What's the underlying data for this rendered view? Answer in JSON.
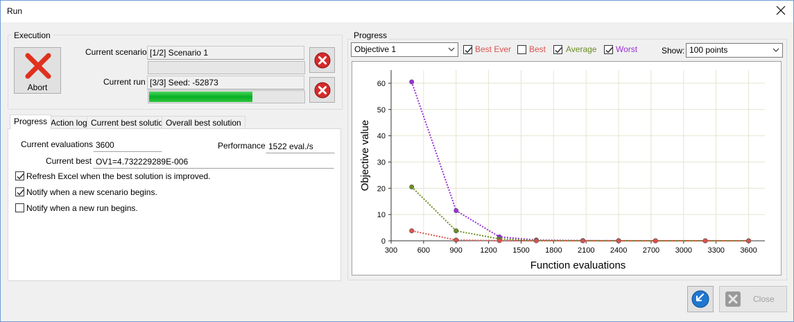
{
  "window": {
    "title": "Run"
  },
  "execution": {
    "group_label": "Execution",
    "abort_label": "Abort",
    "current_scenario_label": "Current scenario",
    "current_scenario_value": "[1/2] Scenario 1",
    "scenario_progress": 0.0,
    "current_run_label": "Current run",
    "current_run_value": "[3/3] Seed: -52873",
    "run_progress": 0.67
  },
  "tabs": [
    {
      "label": "Progress",
      "active": true
    },
    {
      "label": "Action log",
      "active": false
    },
    {
      "label": "Current best solution",
      "active": false
    },
    {
      "label": "Overall best solution",
      "active": false
    }
  ],
  "progress_tab": {
    "current_evaluations_label": "Current evaluations",
    "current_evaluations_value": "3600",
    "performance_label": "Performance",
    "performance_value": "1522 eval./s",
    "current_best_label": "Current best",
    "current_best_value": "OV1=4.732229289E-006",
    "options": [
      {
        "label": "Refresh Excel when the best solution is improved.",
        "checked": true
      },
      {
        "label": "Notify when a new scenario begins.",
        "checked": true
      },
      {
        "label": "Notify when a new run begins.",
        "checked": false
      }
    ]
  },
  "progress_panel": {
    "group_label": "Progress",
    "objective_select": "Objective 1",
    "series_toggles": [
      {
        "label": "Best Ever",
        "checked": true,
        "color": "#d9534f"
      },
      {
        "label": "Best",
        "checked": false,
        "color": "#d9534f"
      },
      {
        "label": "Average",
        "checked": true,
        "color": "#6b8e23"
      },
      {
        "label": "Worst",
        "checked": true,
        "color": "#9b30d9"
      }
    ],
    "show_label": "Show:",
    "show_value": "100 points"
  },
  "chart_data": {
    "type": "line",
    "xlabel": "Function evaluations",
    "ylabel": "Objective value",
    "xlim": [
      300,
      3750
    ],
    "ylim": [
      0,
      65
    ],
    "x_ticks": [
      300,
      600,
      900,
      1200,
      1500,
      1800,
      2100,
      2400,
      2700,
      3000,
      3300,
      3600
    ],
    "y_ticks": [
      0,
      10,
      20,
      30,
      40,
      50,
      60
    ],
    "grid": true,
    "series": [
      {
        "name": "Worst",
        "color": "#9b30d9",
        "x": [
          490,
          900,
          1300,
          1640,
          2070,
          2400,
          2740,
          3200,
          3600
        ],
        "y": [
          60.5,
          11.5,
          1.5,
          0.3,
          0.1,
          0.05,
          0.03,
          0.02,
          0.01
        ]
      },
      {
        "name": "Average",
        "color": "#6b8e23",
        "x": [
          490,
          900,
          1300,
          1640,
          2070,
          2400,
          2740,
          3200,
          3600
        ],
        "y": [
          20.5,
          3.8,
          0.7,
          0.15,
          0.05,
          0.02,
          0.01,
          0.01,
          0.0
        ]
      },
      {
        "name": "Best Ever",
        "color": "#d9534f",
        "x": [
          490,
          900,
          1300,
          1640,
          2070,
          2400,
          2740,
          3200,
          3600
        ],
        "y": [
          3.8,
          0.3,
          0.05,
          0.01,
          0.0,
          0.0,
          0.0,
          0.0,
          0.0
        ]
      }
    ]
  },
  "buttons": {
    "close_label": "Close"
  }
}
